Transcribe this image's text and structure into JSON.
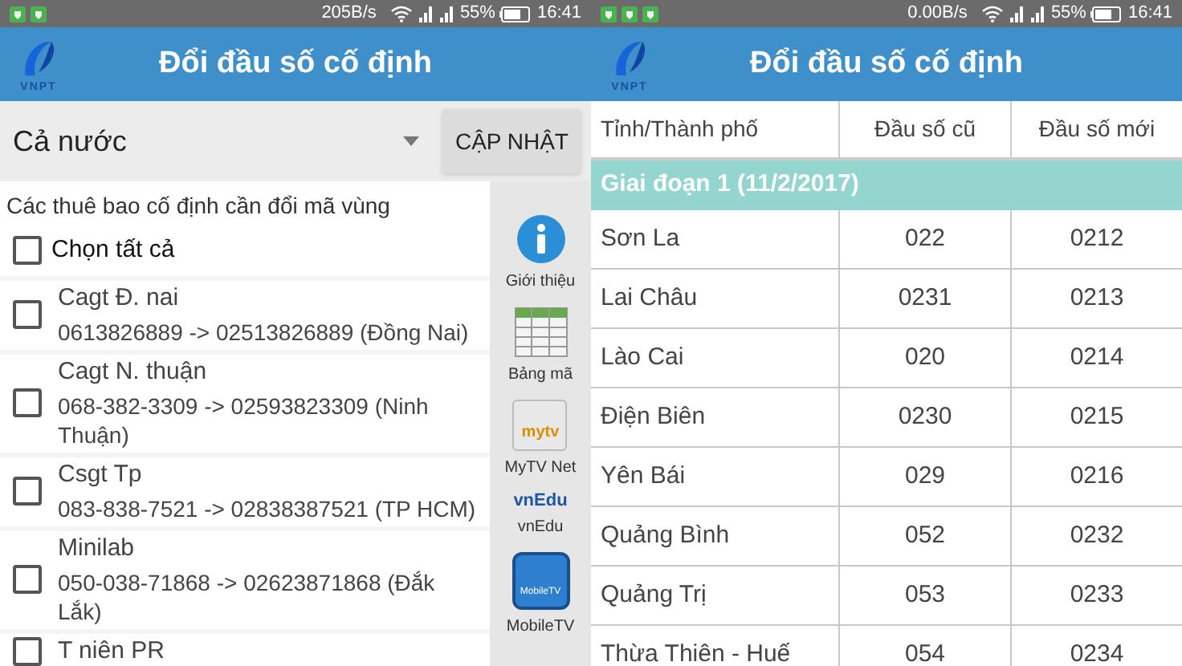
{
  "screens": [
    {
      "status_bar": {
        "speed": "205B/s",
        "battery": "55%",
        "time": "16:41"
      },
      "app_bar": {
        "logo": "VNPT",
        "title": "Đổi đầu số cố định"
      },
      "region_select": {
        "value": "Cả nước"
      },
      "update_button": "CẬP NHẬT",
      "list_title": "Các thuê bao cố định cần đổi mã vùng",
      "select_all": {
        "label": "Chọn tất cả",
        "checked": false
      },
      "subscribers": [
        {
          "name": "Cagt Đ. nai",
          "change": "0613826889 -> 02513826889 (Đồng Nai)",
          "checked": false
        },
        {
          "name": "Cagt N. thuận",
          "change": "068-382-3309 -> 02593823309 (Ninh Thuận)",
          "checked": false
        },
        {
          "name": "Csgt Tp",
          "change": "083-838-7521 -> 02838387521 (TP HCM)",
          "checked": false
        },
        {
          "name": "Minilab",
          "change": "050-038-71868 -> 02623871868 (Đắk Lắk)",
          "checked": false
        },
        {
          "name": "T niên PR",
          "checked": false
        }
      ],
      "side_menu": [
        {
          "kind": "info",
          "label": "Giới thiệu"
        },
        {
          "kind": "table",
          "label": "Bảng mã"
        },
        {
          "kind": "mytv",
          "label": "MyTV Net",
          "badge": "mytv"
        },
        {
          "kind": "vnedu",
          "label": "vnEdu",
          "badge": "vnEdu"
        },
        {
          "kind": "mobiletv",
          "label": "MobileTV",
          "badge": "MobileTV"
        }
      ]
    },
    {
      "status_bar": {
        "speed": "0.00B/s",
        "battery": "55%",
        "time": "16:41"
      },
      "app_bar": {
        "logo": "VNPT",
        "title": "Đổi đầu số cố định"
      },
      "table": {
        "columns": [
          "Tỉnh/Thành phố",
          "Đầu số cũ",
          "Đầu số mới"
        ],
        "group": "Giai đoạn 1 (11/2/2017)",
        "rows": [
          [
            "Sơn La",
            "022",
            "0212"
          ],
          [
            "Lai Châu",
            "0231",
            "0213"
          ],
          [
            "Lào Cai",
            "020",
            "0214"
          ],
          [
            "Điện Biên",
            "0230",
            "0215"
          ],
          [
            "Yên Bái",
            "029",
            "0216"
          ],
          [
            "Quảng Bình",
            "052",
            "0232"
          ],
          [
            "Quảng Trị",
            "053",
            "0233"
          ],
          [
            "Thừa Thiên - Huế",
            "054",
            "0234"
          ]
        ]
      }
    }
  ]
}
